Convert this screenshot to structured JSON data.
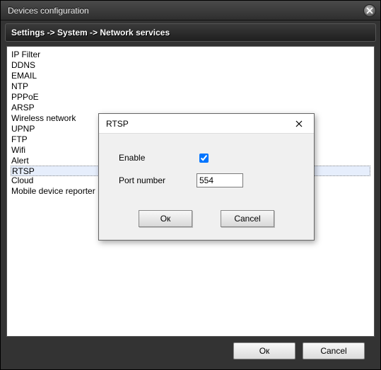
{
  "window": {
    "title": "Devices configuration"
  },
  "breadcrumb": {
    "part1": "Settings",
    "sep": " -> ",
    "part2": "System",
    "part3": "Network services"
  },
  "services": {
    "items": [
      "IP Filter",
      "DDNS",
      "EMAIL",
      "NTP",
      "PPPoE",
      "ARSP",
      "Wireless network",
      "UPNP",
      "FTP",
      "Wifi",
      "Alert",
      "RTSP",
      "Cloud",
      "Mobile device reporter"
    ],
    "selected_index": 11
  },
  "main_buttons": {
    "ok": "Ок",
    "cancel": "Cancel"
  },
  "dialog": {
    "title": "RTSP",
    "enable_label": "Enable",
    "enable_checked": true,
    "port_label": "Port number",
    "port_value": "554",
    "ok": "Ок",
    "cancel": "Cancel"
  }
}
